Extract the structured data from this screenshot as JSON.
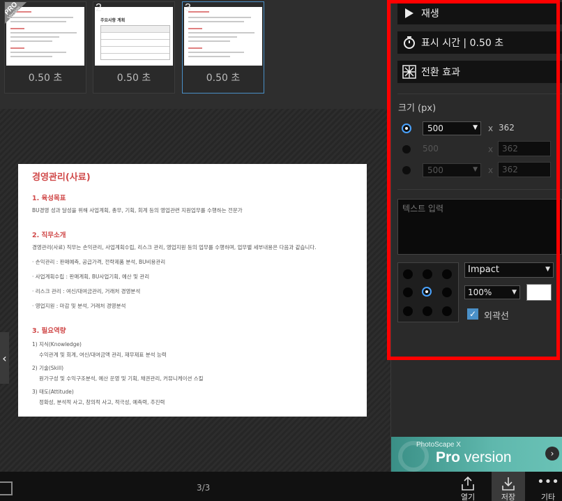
{
  "thumbnails": [
    {
      "number": "",
      "duration": "0.50 초",
      "selected": false
    },
    {
      "number": "2",
      "duration": "0.50 초",
      "selected": false
    },
    {
      "number": "3",
      "duration": "0.50 초",
      "selected": true
    }
  ],
  "badge": {
    "line1": "PRO",
    "line2": "Version"
  },
  "thumb2_table_title": "주요사항 계획",
  "document": {
    "title": "경영관리(사료)",
    "sections": [
      {
        "heading": "1. 육성목표",
        "lines": [
          "BU경영 성과 달성을 위해 사업계획, 총무, 기획, 회계 등의 영업관련 지원업무를 수행하는 전문가"
        ]
      },
      {
        "heading": "2. 직무소개",
        "lines": [
          "경영관리(사료) 직무는 손익관리, 사업계획수립, 리스크 관리, 영업지원 등의 업무를 수행하며, 업무별 세부내용은 다음과 같습니다.",
          "· 손익관리 : 판매예측, 공급가격, 전략제품 분석, BU비용관리",
          "· 사업계획수립 : 판매계획, BU사업기획, 예산 및 관리",
          "· 리스크 관리 : 여신/대여금관리, 거래처 경영분석",
          "· 영업지원 : 마감 및 분석, 거래처 경영분석"
        ]
      },
      {
        "heading": "3. 필요역량",
        "items": [
          {
            "label": "1) 지식(Knowledge)",
            "detail": "수익관계 및 회계, 여신/대여금액 관리, 재무제표 분석 능력"
          },
          {
            "label": "2) 기술(Skill)",
            "detail": "원가구성 및 수익구조분석, 예산 운영 및 기획, 채권관리, 커뮤니케이션 스킬"
          },
          {
            "label": "3) 태도(Attitude)",
            "detail": "정확성, 분석적 사고, 창의적 사고, 적극성, 예측력, 추진력"
          }
        ]
      }
    ]
  },
  "panel": {
    "play_label": "재생",
    "display_time_label": "표시 시간 | 0.50 초",
    "transition_label": "전환 효과",
    "size_label": "크기 (px)",
    "size_rows": [
      {
        "width": "500",
        "height": "362",
        "enabled": true
      },
      {
        "width": "500",
        "height": "362",
        "enabled": false
      },
      {
        "width": "500",
        "height": "362",
        "enabled": false
      }
    ],
    "x_symbol": "x",
    "text_placeholder": "텍스트 입력",
    "font": "Impact",
    "font_size": "100%",
    "outline_label": "외곽선",
    "outline_checked": true,
    "text_color": "#ffffff"
  },
  "banner": {
    "small": "PhotoScape X",
    "pro": "Pro",
    "version": " version"
  },
  "bottom": {
    "page_indicator": "3/3",
    "open_label": "열기",
    "save_label": "저장",
    "more_label": "기타"
  },
  "colors": {
    "accent": "#4a90c8",
    "highlight_box": "#ff0000",
    "heading_red": "#d04a4a"
  }
}
